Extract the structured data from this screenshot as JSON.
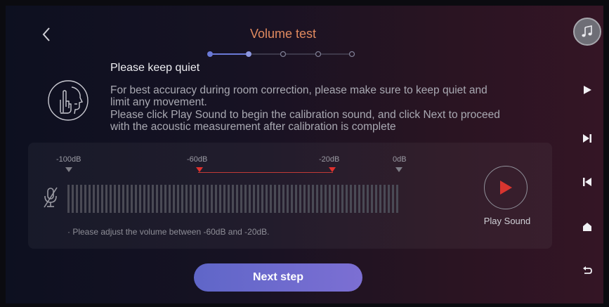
{
  "header": {
    "title": "Volume test"
  },
  "progress": {
    "total_steps": 5,
    "current_step": 2
  },
  "content": {
    "heading": "Please keep quiet",
    "description": [
      "For best accuracy during room correction, please make sure to keep quiet and",
      "limit any movement.",
      "Please click Play Sound to begin the calibration sound, and click Next to proceed",
      "with the acoustic measurement after calibration is complete"
    ]
  },
  "meter": {
    "labels": [
      "-100dB",
      "-60dB",
      "-20dB",
      "0dB"
    ],
    "hint": "· Please adjust the volume between -60dB and -20dB.",
    "play_label": "Play Sound"
  },
  "footer": {
    "next_label": "Next step"
  },
  "sidebar": {
    "icons": [
      "music-note-icon",
      "play-icon",
      "skip-next-icon",
      "skip-previous-icon",
      "home-icon",
      "return-icon"
    ]
  },
  "colors": {
    "accent": "#e08a5f",
    "marker_red": "#e0312e",
    "button": "#6a6bd0"
  }
}
